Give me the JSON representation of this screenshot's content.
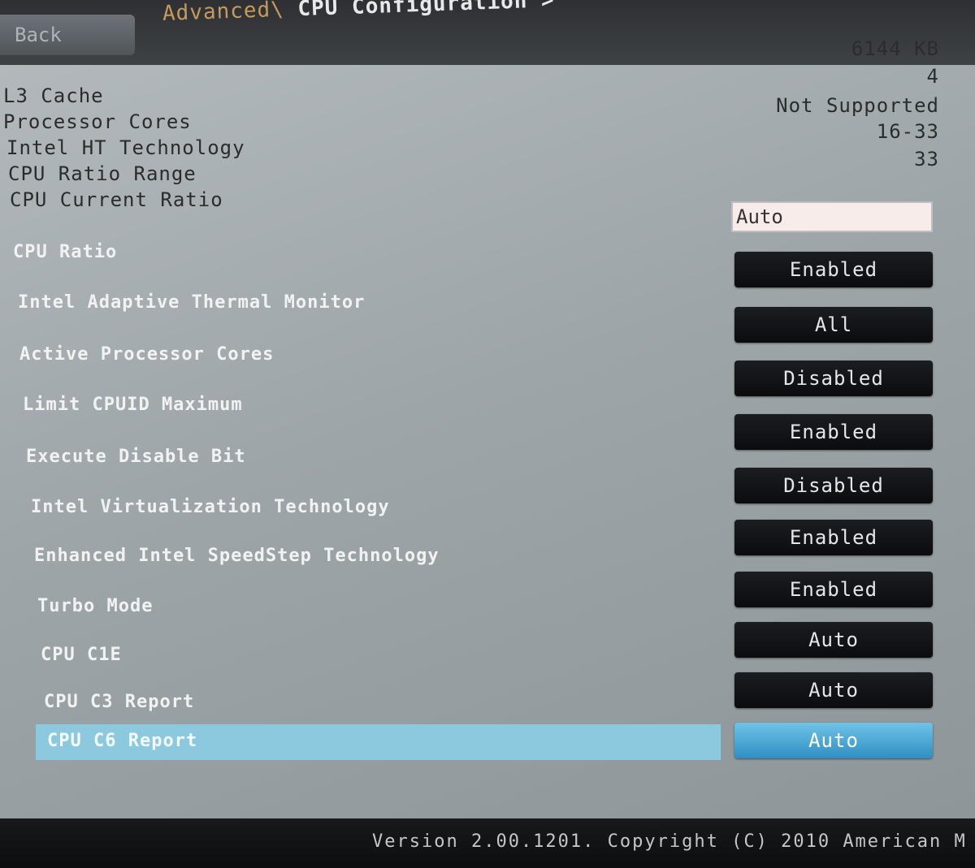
{
  "header": {
    "back_label": "Back",
    "breadcrumb_parent": "Advanced\\",
    "breadcrumb_current": "CPU Configuration >"
  },
  "info": [
    {
      "label": "L3 Cache",
      "value": "6144 KB"
    },
    {
      "label": "Processor Cores",
      "value": "4"
    },
    {
      "label": "Intel HT Technology",
      "value": "Not Supported"
    },
    {
      "label": "CPU Ratio Range",
      "value": "16-33"
    },
    {
      "label": "CPU Current Ratio",
      "value": "33"
    }
  ],
  "cpu_ratio": {
    "label": "CPU Ratio",
    "value": "Auto"
  },
  "settings": [
    {
      "label": "Intel Adaptive Thermal Monitor",
      "value": "Enabled"
    },
    {
      "label": "Active Processor Cores",
      "value": "All"
    },
    {
      "label": "Limit CPUID Maximum",
      "value": "Disabled"
    },
    {
      "label": "Execute Disable Bit",
      "value": "Enabled"
    },
    {
      "label": "Intel Virtualization Technology",
      "value": "Disabled"
    },
    {
      "label": "Enhanced Intel SpeedStep Technology",
      "value": "Enabled"
    },
    {
      "label": "Turbo Mode",
      "value": "Enabled"
    },
    {
      "label": "CPU C1E",
      "value": "Auto"
    },
    {
      "label": "CPU C3 Report",
      "value": "Auto"
    },
    {
      "label": "CPU C6 Report",
      "value": "Auto"
    }
  ],
  "footer": {
    "version_text": "Version 2.00.1201. Copyright (C) 2010 American M"
  },
  "colors": {
    "panel": "#a5acb0",
    "selected_row": "#8cc9de",
    "selected_button": "#4aa8d8",
    "button": "#121417"
  }
}
